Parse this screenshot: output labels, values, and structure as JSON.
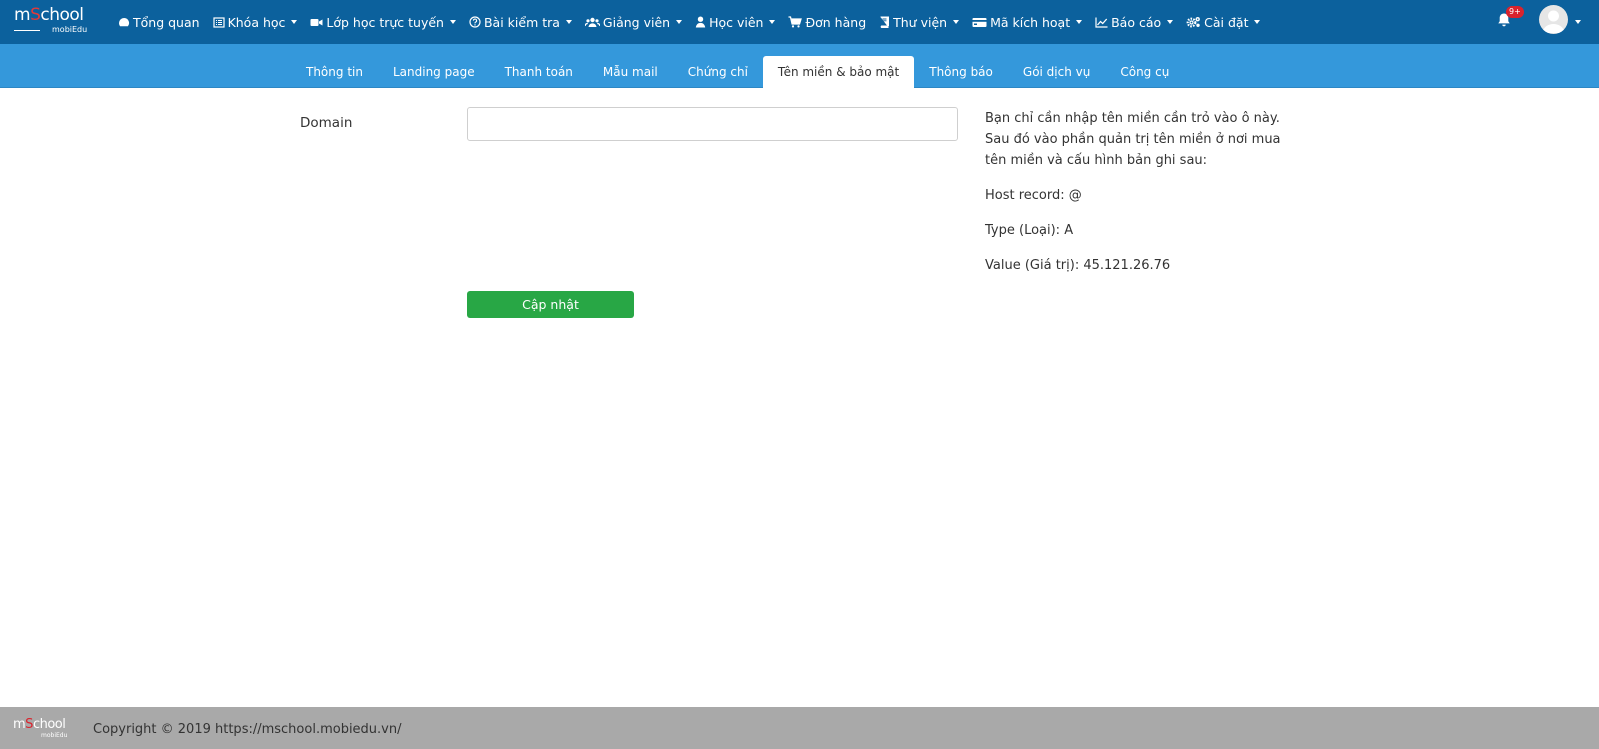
{
  "app": {
    "logo_text_a": "m",
    "logo_text_b": "S",
    "logo_text_c": "chool",
    "logo_sub": "mobiEdu"
  },
  "nav": {
    "items": [
      {
        "label": "Tổng quan",
        "icon": "dashboard-icon",
        "has_caret": false
      },
      {
        "label": "Khóa học",
        "icon": "list-icon",
        "has_caret": true
      },
      {
        "label": "Lớp học trực tuyến",
        "icon": "video-camera-icon",
        "has_caret": true
      },
      {
        "label": "Bài kiểm tra",
        "icon": "question-circle-icon",
        "has_caret": true
      },
      {
        "label": "Giảng viên",
        "icon": "users-icon",
        "has_caret": true
      },
      {
        "label": "Học viên",
        "icon": "user-icon",
        "has_caret": true
      },
      {
        "label": "Đơn hàng",
        "icon": "cart-icon",
        "has_caret": false
      },
      {
        "label": "Thư viện",
        "icon": "book-icon",
        "has_caret": true
      },
      {
        "label": "Mã kích hoạt",
        "icon": "credit-card-icon",
        "has_caret": true
      },
      {
        "label": "Báo cáo",
        "icon": "line-chart-icon",
        "has_caret": true
      },
      {
        "label": "Cài đặt",
        "icon": "gears-icon",
        "has_caret": true
      }
    ],
    "notification_badge": "9+"
  },
  "tabs": [
    {
      "label": "Thông tin",
      "active": false
    },
    {
      "label": "Landing page",
      "active": false
    },
    {
      "label": "Thanh toán",
      "active": false
    },
    {
      "label": "Mẫu mail",
      "active": false
    },
    {
      "label": "Chứng chỉ",
      "active": false
    },
    {
      "label": "Tên miền & bảo mật",
      "active": true
    },
    {
      "label": "Thông báo",
      "active": false
    },
    {
      "label": "Gói dịch vụ",
      "active": false
    },
    {
      "label": "Công cụ",
      "active": false
    }
  ],
  "form": {
    "domain_label": "Domain",
    "domain_value": "",
    "domain_placeholder": "",
    "update_label": "Cập nhật"
  },
  "help": {
    "intro": "Bạn chỉ cần nhập tên miền cần trỏ vào ô này. Sau đó vào phần quản trị tên miền ở nơi mua tên miền và cấu hình bản ghi sau:",
    "host_record": "Host record: @",
    "type": "Type (Loại): A",
    "value": "Value (Giá trị): 45.121.26.76"
  },
  "footer": {
    "copyright": "Copyright © 2019 https://mschool.mobiedu.vn/"
  },
  "colors": {
    "navbar": "#0c619d",
    "tabbar": "#3498db",
    "update_button": "#28a745",
    "footer": "#a9a9a9"
  }
}
